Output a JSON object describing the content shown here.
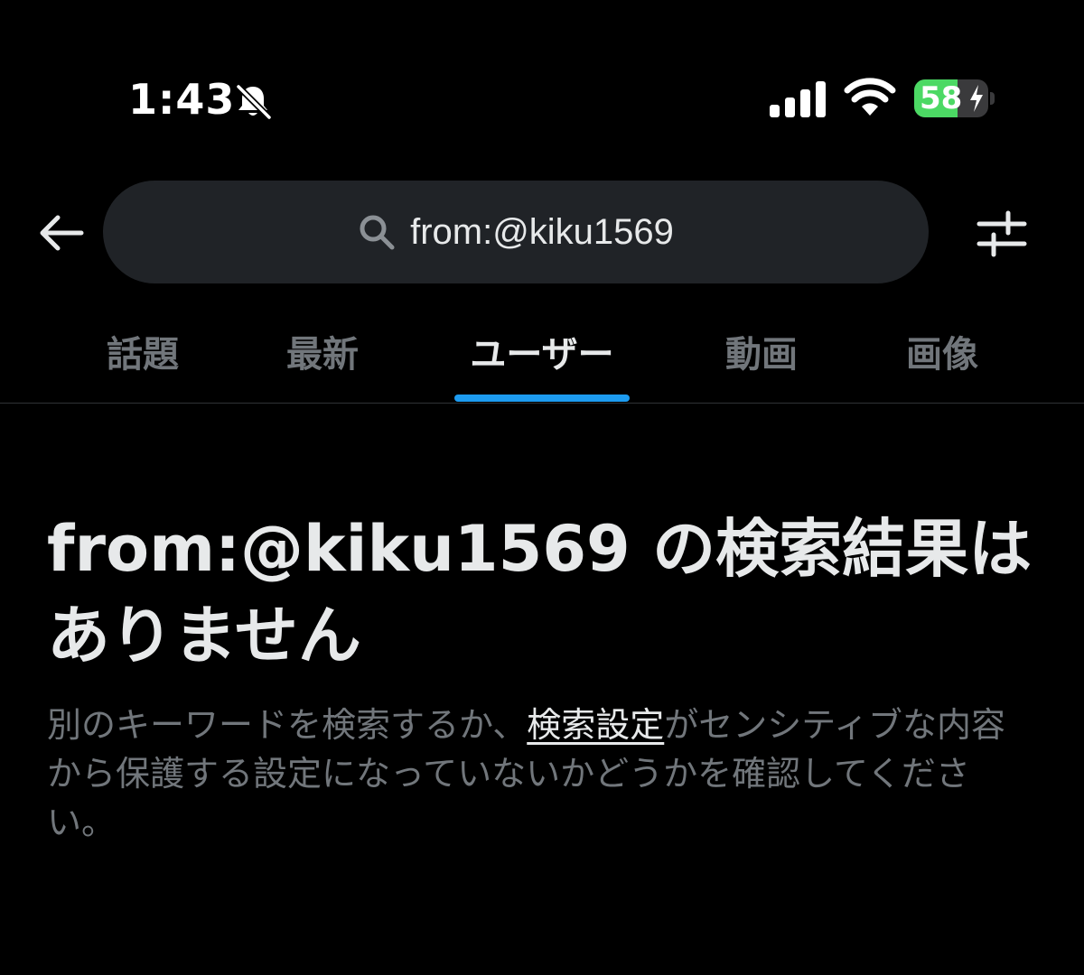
{
  "status_bar": {
    "time": "1:43",
    "battery_level": "58",
    "battery_fraction": 0.58,
    "icons": [
      "bell-muted-icon",
      "cellular-signal-icon",
      "wifi-icon",
      "battery-charging-icon"
    ]
  },
  "search": {
    "query": "from:@kiku1569",
    "back_icon": "arrow-left-icon",
    "search_icon": "magnifier-icon",
    "filter_icon": "sliders-icon"
  },
  "tabs": [
    {
      "label": "話題",
      "active": false
    },
    {
      "label": "最新",
      "active": false
    },
    {
      "label": "ユーザー",
      "active": true
    },
    {
      "label": "動画",
      "active": false
    },
    {
      "label": "画像",
      "active": false
    }
  ],
  "empty_state": {
    "title": "from:@kiku1569 の検索結果はありません",
    "desc_prefix": "別のキーワードを検索するか、",
    "desc_link": "検索設定",
    "desc_suffix": "がセンシティブな内容から保護する設定になっていないかどうかを確認してください。"
  },
  "colors": {
    "background": "#000000",
    "accent": "#1d9bf0",
    "muted_text": "#71767b",
    "primary_text": "#e7e9ea",
    "search_bg": "#202327",
    "battery_green": "#4cd964"
  }
}
